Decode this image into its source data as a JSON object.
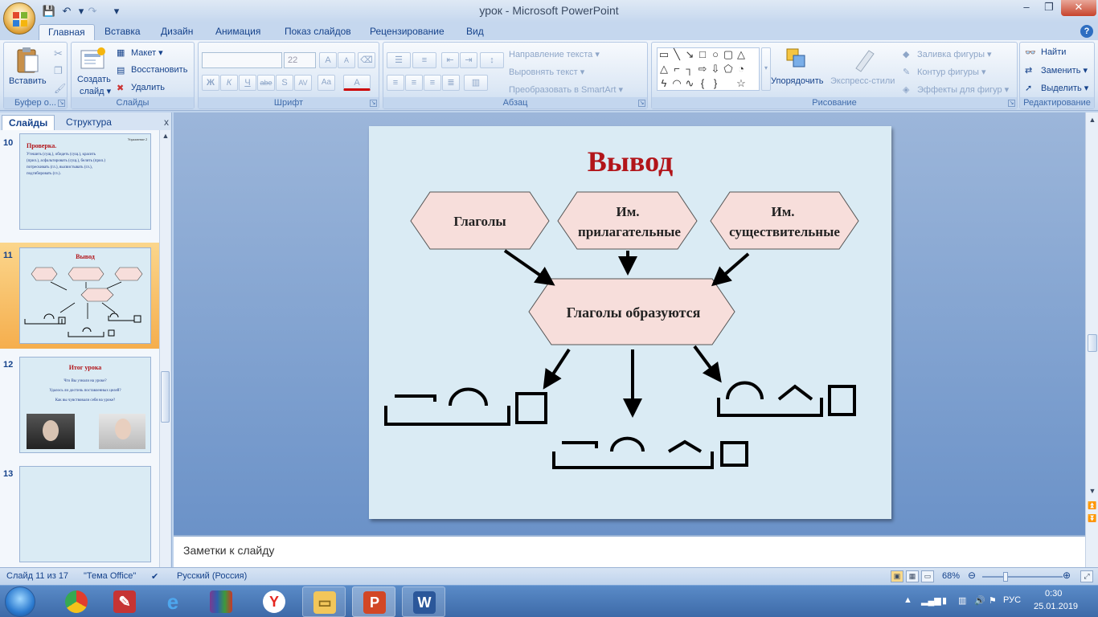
{
  "window": {
    "title": "урок - Microsoft PowerPoint",
    "minimize": "–",
    "restore": "❐",
    "close": "✕"
  },
  "quick_access": {
    "save": "💾",
    "undo": "↶",
    "redo": "↷",
    "customize": "▾"
  },
  "tabs": [
    {
      "label": "Главная",
      "active": true
    },
    {
      "label": "Вставка"
    },
    {
      "label": "Дизайн"
    },
    {
      "label": "Анимация"
    },
    {
      "label": "Показ слайдов"
    },
    {
      "label": "Рецензирование"
    },
    {
      "label": "Вид"
    }
  ],
  "ribbon": {
    "clipboard": {
      "label": "Буфер о...",
      "paste": "Вставить"
    },
    "slides": {
      "label": "Слайды",
      "new_slide": "Создать",
      "new_slide_2": "слайд ▾",
      "layout": "Макет ▾",
      "reset": "Восстановить",
      "delete": "Удалить"
    },
    "font": {
      "label": "Шрифт",
      "font_name": "",
      "font_size": "22",
      "bold": "Ж",
      "italic": "К",
      "underline": "Ч",
      "strike": "abe",
      "shadow": "S",
      "spacing": "AV",
      "case": "Aa",
      "color": "A",
      "grow": "A",
      "shrink": "A"
    },
    "paragraph": {
      "label": "Абзац",
      "text_direction": "Направление текста ▾",
      "align_text": "Выровнять текст ▾",
      "smartart": "Преобразовать в SmartArt ▾"
    },
    "drawing": {
      "label": "Рисование",
      "arrange": "Упорядочить",
      "quick_styles": "Экспресс-стили",
      "shape_fill": "Заливка фигуры ▾",
      "shape_outline": "Контур фигуры ▾",
      "shape_effects": "Эффекты для фигур ▾"
    },
    "editing": {
      "label": "Редактирование",
      "find": "Найти",
      "replace": "Заменить ▾",
      "select": "Выделить ▾"
    }
  },
  "panel": {
    "tab_slides": "Слайды",
    "tab_outline": "Структура",
    "close": "x",
    "thumbnails": [
      {
        "number": "10",
        "title": "Проверка.",
        "corner": "Упражнение 2",
        "lines": [
          "Утешить (сущ.), обидеть (сущ.), красить",
          "(прил.), асфальтировать (сущ.), белить (прил.)",
          "потрескивать (гл.), высвистывать (гл.),",
          "подгибировать (гл.)."
        ]
      },
      {
        "number": "11",
        "title": "Вывод",
        "selected": true
      },
      {
        "number": "12",
        "title": "Итог урока",
        "bullets": [
          "Что Вы узнали на уроке?",
          "Удалось ли достичь поставленных целей?",
          "Как вы чувствовали себя на уроке?"
        ]
      },
      {
        "number": "13",
        "title": ""
      }
    ]
  },
  "slide": {
    "title": "Вывод",
    "hex_verbs": "Глаголы",
    "hex_adj_1": "Им.",
    "hex_adj_2": "прилагательные",
    "hex_noun_1": "Им.",
    "hex_noun_2": "существительные",
    "hex_center": "Глаголы образуются"
  },
  "notes": {
    "placeholder": "Заметки к слайду"
  },
  "status": {
    "slide_counter": "Слайд 11 из 17",
    "theme": "\"Тема Office\"",
    "language": "Русский (Россия)",
    "zoom": "68%"
  },
  "taskbar": {
    "lang": "РУС",
    "time": "0:30",
    "date": "25.01.2019"
  },
  "colors": {
    "slide_bg": "#daebf4",
    "hex_fill": "#f7dedb",
    "title_red": "#b2151a",
    "ribbon_text": "#15428b",
    "selected_thumb": "#f5ae4d"
  }
}
